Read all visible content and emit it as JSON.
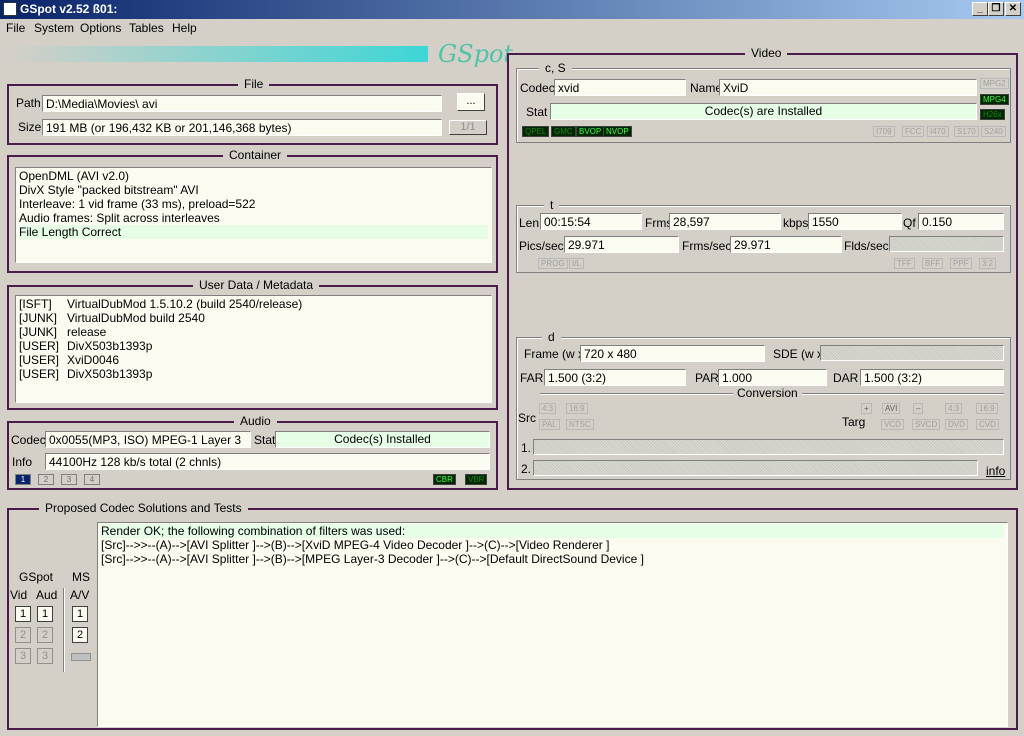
{
  "window": {
    "title": "GSpot v2.52 ß01:",
    "controls": [
      "_",
      "❐",
      "✕"
    ]
  },
  "menu": [
    "File",
    "System",
    "Options",
    "Tables",
    "Help"
  ],
  "logo_text": "GSpot",
  "file": {
    "title": "File",
    "path_label": "Path",
    "path_value": "D:\\Media\\Movies\\  avi",
    "browse_label": "...",
    "size_label": "Size",
    "size_value": "191 MB (or 196,432 KB or 201,146,368 bytes)",
    "page_label": "1/1"
  },
  "container": {
    "title": "Container",
    "lines": [
      "OpenDML (AVI v2.0)",
      "DivX Style \"packed bitstream\" AVI",
      "Interleave: 1 vid frame (33 ms), preload=522",
      "Audio frames: Split across interleaves",
      "File Length Correct"
    ]
  },
  "metadata": {
    "title": "User Data / Metadata",
    "rows": [
      {
        "tag": "[ISFT]",
        "value": "VirtualDubMod 1.5.10.2 (build 2540/release)"
      },
      {
        "tag": "[JUNK]",
        "value": "VirtualDubMod build 2540"
      },
      {
        "tag": "[JUNK]",
        "value": "release"
      },
      {
        "tag": "[USER]",
        "value": "DivX503b1393p"
      },
      {
        "tag": "[USER]",
        "value": "XviD0046"
      },
      {
        "tag": "[USER]",
        "value": "DivX503b1393p"
      }
    ]
  },
  "audio": {
    "title": "Audio",
    "codec_label": "Codec",
    "codec_value": "0x0055(MP3, ISO) MPEG-1 Layer 3",
    "stat_label": "Stat",
    "stat_value": "Codec(s) Installed",
    "info_label": "Info",
    "info_value": "44100Hz  128 kb/s total (2 chnls)",
    "streams": [
      "1",
      "2",
      "3",
      "4"
    ],
    "cbr": "CBR",
    "vbr": "VBR"
  },
  "video": {
    "title": "Video",
    "cs": {
      "title": "c, S",
      "codec_label": "Codec",
      "codec_value": "xvid",
      "name_label": "Name",
      "name_value": "XviD",
      "stat_label": "Stat",
      "stat_value": "Codec(s) are Installed",
      "side_flags": [
        "MPG2",
        "MPG4",
        "H26x"
      ],
      "gflags": [
        "QPEL",
        "GMC",
        "BVOP",
        "NVOP"
      ],
      "tiny_flags": [
        "I709",
        "FCC",
        "I470",
        "S170",
        "S240"
      ]
    },
    "t": {
      "title": "t",
      "len_label": "Len",
      "len_value": "00:15:54",
      "frms_label": "Frms",
      "frms_value": "28,597",
      "kbps_label": "kbps",
      "kbps_value": "1550",
      "qf_label": "Qf",
      "qf_value": "0.150",
      "pics_label": "Pics/sec",
      "pics_value": "29.971",
      "frmsps_label": "Frms/sec",
      "frmsps_value": "29.971",
      "flds_label": "Flds/sec",
      "left_flags": [
        "PROG",
        "I/L"
      ],
      "right_flags": [
        "TFF",
        "BFF",
        "PPF",
        "3:2"
      ]
    },
    "d": {
      "title": "d",
      "frame_label": "Frame (w x",
      "frame_value": "720 x 480",
      "sde_label": "SDE (w x",
      "far_label": "FAR",
      "far_value": "1.500 (3:2)",
      "par_label": "PAR",
      "par_value": "1.000",
      "dar_label": "DAR",
      "dar_value": "1.500 (3:2)",
      "conversion_label": "Conversion",
      "src_label": "Src",
      "src_btns": [
        "4:3",
        "16:9",
        "PAL",
        "NTSC"
      ],
      "targ_label": "Targ",
      "targ_top": [
        "+",
        "AVI",
        "–",
        "4:3",
        "16:9"
      ],
      "targ_bottom": [
        "VCD",
        "SVCD",
        "DVD",
        "CVD"
      ],
      "row1": "1.",
      "row2": "2.",
      "info_link": "info"
    }
  },
  "proposed": {
    "title": "Proposed Codec Solutions and Tests",
    "gspot_label": "GSpot",
    "ms_label": "MS",
    "vid_label": "Vid",
    "aud_label": "Aud",
    "av_label": "A/V",
    "nums": [
      "1",
      "2",
      "3"
    ],
    "lines": [
      "Render OK; the following combination of filters was used:",
      "[Src]-->>--(A)-->[AVI Splitter ]-->(B)-->[XviD MPEG-4 Video Decoder ]-->(C)-->[Video Renderer ]",
      "[Src]-->>--(A)-->[AVI Splitter ]-->(B)-->[MPEG Layer-3 Decoder ]-->(C)-->[Default DirectSound Device ]"
    ]
  }
}
